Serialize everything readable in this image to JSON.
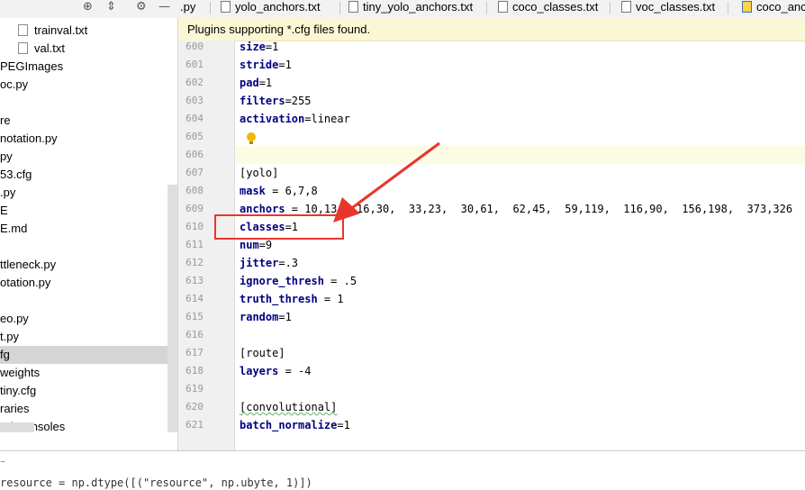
{
  "tabs": [
    {
      "label": ".py",
      "icon": "python-file-icon"
    },
    {
      "label": "yolo_anchors.txt",
      "icon": "text-file-icon"
    },
    {
      "label": "tiny_yolo_anchors.txt",
      "icon": "text-file-icon"
    },
    {
      "label": "coco_classes.txt",
      "icon": "text-file-icon"
    },
    {
      "label": "voc_classes.txt",
      "icon": "text-file-icon"
    },
    {
      "label": "coco_anc",
      "icon": "python-file-icon"
    }
  ],
  "toolbar": {
    "locate_icon": "⊕",
    "collapse_icon": "⇕",
    "gear_icon": "⚙",
    "hide_icon": "—"
  },
  "sidebar": {
    "items": [
      {
        "label": "trainval.txt",
        "file": true
      },
      {
        "label": "val.txt",
        "file": true
      },
      {
        "label": "PEGImages"
      },
      {
        "label": "oc.py"
      },
      {
        "label": ""
      },
      {
        "label": "re"
      },
      {
        "label": "notation.py"
      },
      {
        "label": "py"
      },
      {
        "label": "53.cfg"
      },
      {
        "label": ".py"
      },
      {
        "label": "E"
      },
      {
        "label": "E.md"
      },
      {
        "label": ""
      },
      {
        "label": "ttleneck.py"
      },
      {
        "label": "otation.py"
      },
      {
        "label": ""
      },
      {
        "label": "eo.py"
      },
      {
        "label": "t.py"
      },
      {
        "label": "fg",
        "selected": true
      },
      {
        "label": "weights"
      },
      {
        "label": "tiny.cfg"
      },
      {
        "label": "raries"
      },
      {
        "label": "nd Consoles"
      }
    ]
  },
  "notice": {
    "text": "Plugins supporting *.cfg files found."
  },
  "editor": {
    "lines": [
      {
        "num": "600",
        "key": "size",
        "rest": "=1"
      },
      {
        "num": "601",
        "key": "stride",
        "rest": "=1"
      },
      {
        "num": "602",
        "key": "pad",
        "rest": "=1"
      },
      {
        "num": "603",
        "key": "filters",
        "rest": "=255"
      },
      {
        "num": "604",
        "key": "activation",
        "rest": "=linear"
      },
      {
        "num": "605",
        "key": "",
        "rest": ""
      },
      {
        "num": "606",
        "key": "",
        "rest": ""
      },
      {
        "num": "607",
        "key": "",
        "rest": "[yolo]"
      },
      {
        "num": "608",
        "key": "mask",
        "rest": " = 6,7,8"
      },
      {
        "num": "609",
        "key": "anchors",
        "rest": " = 10,13,  16,30,  33,23,  30,61,  62,45,  59,119,  116,90,  156,198,  373,326"
      },
      {
        "num": "610",
        "key": "classes",
        "rest": "=1"
      },
      {
        "num": "611",
        "key": "num",
        "rest": "=9"
      },
      {
        "num": "612",
        "key": "jitter",
        "rest": "=.3"
      },
      {
        "num": "613",
        "key": "ignore_thresh",
        "rest": " = .5"
      },
      {
        "num": "614",
        "key": "truth_thresh",
        "rest": " = 1"
      },
      {
        "num": "615",
        "key": "random",
        "rest": "=1"
      },
      {
        "num": "616",
        "key": "",
        "rest": ""
      },
      {
        "num": "617",
        "key": "",
        "rest": "[route]"
      },
      {
        "num": "618",
        "key": "layers",
        "rest": " = -4"
      },
      {
        "num": "619",
        "key": "",
        "rest": ""
      },
      {
        "num": "620",
        "key": "",
        "rest": "[convolutional]"
      },
      {
        "num": "621",
        "key": "batch_normalize",
        "rest": "=1"
      }
    ]
  },
  "console": {
    "text": "resource = np.dtype([(\"resource\", np.ubyte, 1)])"
  },
  "colors": {
    "annotation": "#e8362b",
    "keyword": "#000080",
    "notice_bg": "#fbf7d5"
  }
}
